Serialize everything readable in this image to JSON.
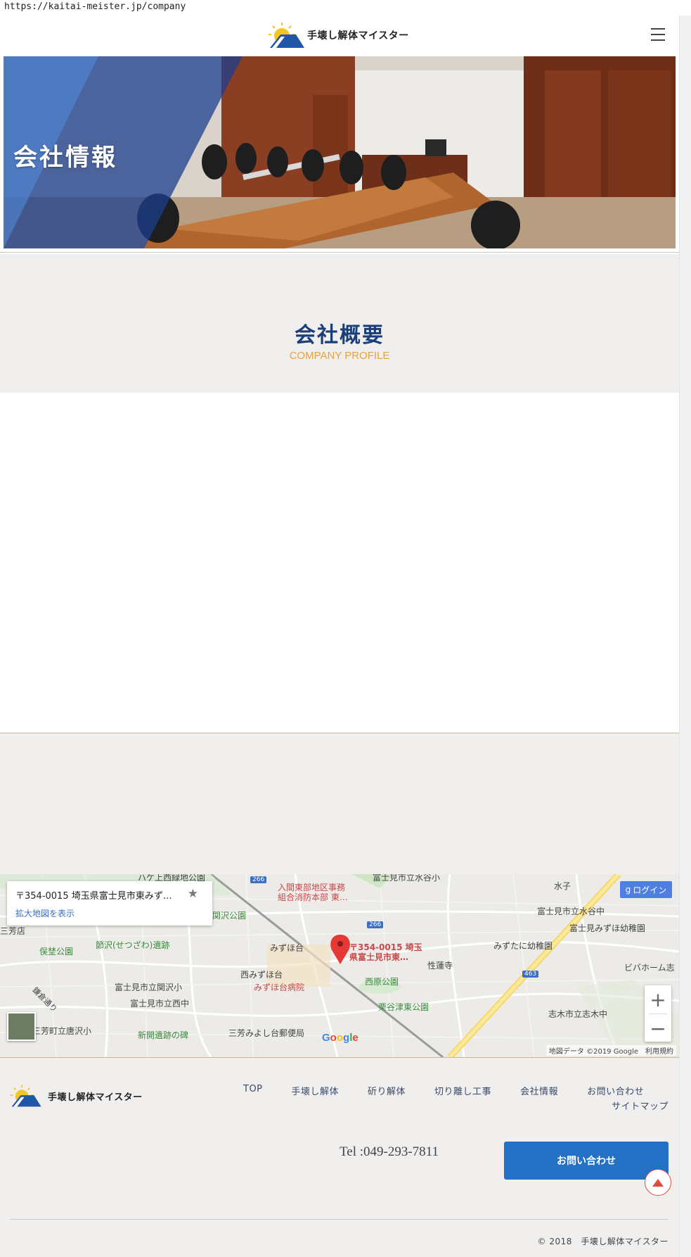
{
  "browser": {
    "url": "https://kaitai-meister.jp/company"
  },
  "header": {
    "logo_text": "手壊し解体マイスター",
    "menu_icon": "hamburger-menu-icon"
  },
  "hero": {
    "title": "会社情報"
  },
  "profile": {
    "title": "会社概要",
    "subtitle": "COMPANY PROFILE"
  },
  "map": {
    "card_title": "〒354-0015 埼玉県富士見市東みず…",
    "card_link": "拡大地図を表示",
    "login_label": "ログイン",
    "zoom_in": "+",
    "zoom_out": "−",
    "attribution": "地図データ ©2019 Google　利用規約",
    "google_label": "Google",
    "pin_label_1": "〒354-0015 埼玉",
    "pin_label_2": "県富士見市東…",
    "labels": {
      "l1": "ハケ上西緑地公園",
      "l2": "入間東部地区事務",
      "l3": "組合消防本部 東…",
      "l4": "富士見市立水谷小",
      "l5": "水子",
      "l6": "富士見市立水谷中",
      "l7": "富士見みずほ幼稚園",
      "l8": "関沢公園",
      "l9": "三芳店",
      "l10": "節沢(せつざわ)遺跡",
      "l11": "俣埜公園",
      "l12": "みずほ台",
      "l13": "みずたに幼稚園",
      "l14": "性蓮寺",
      "l15": "ビバホーム志",
      "l16": "西みずほ台",
      "l17": "みずほ台病院",
      "l18": "西原公園",
      "l19": "富士見市立関沢小",
      "l20": "富士見市立西中",
      "l21": "栗谷津東公園",
      "l22": "志木市立志木中",
      "l23": "鎌倉通り",
      "l24": "三芳町立唐沢小",
      "l25": "新開遺跡の碑",
      "l26": "三芳みよし台郵便局",
      "r1": "266",
      "r2": "266",
      "r3": "463"
    }
  },
  "footer": {
    "logo_text": "手壊し解体マイスター",
    "nav": [
      "TOP",
      "手壊し解体",
      "斫り解体",
      "切り離し工事",
      "会社情報",
      "お問い合わせ"
    ],
    "sitemap": "サイトマップ",
    "tel": "Tel :049-293-7811",
    "contact_button": "お問い合わせ",
    "copyright": "© 2018　手壊し解体マイスター"
  },
  "colors": {
    "brand_navy": "#1a3e78",
    "accent_orange": "#e8a23a",
    "button_blue": "#2470c4",
    "pagetop_red": "#e34a3a"
  }
}
